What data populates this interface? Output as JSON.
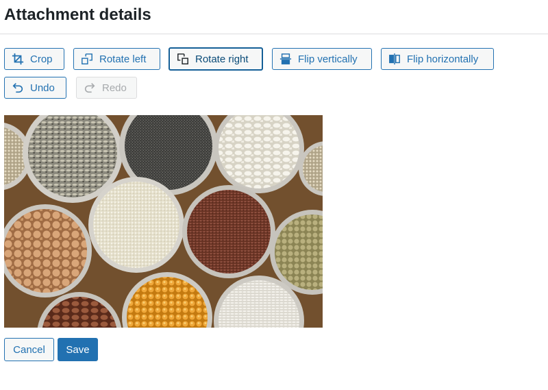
{
  "page": {
    "title": "Attachment details"
  },
  "toolbar": {
    "crop_label": "Crop",
    "rotate_left_label": "Rotate left",
    "rotate_right_label": "Rotate right",
    "flip_vertical_label": "Flip vertically",
    "flip_horizontal_label": "Flip horizontally",
    "undo_label": "Undo",
    "redo_label": "Redo"
  },
  "icons": [
    "crop-icon",
    "rotate-left-icon",
    "rotate-right-icon",
    "flip-vertical-icon",
    "flip-horizontal-icon",
    "undo-icon",
    "redo-icon"
  ],
  "actions": {
    "cancel_label": "Cancel",
    "save_label": "Save"
  },
  "colors": {
    "accent": "#2271b1",
    "accent_dark": "#135e96",
    "disabled": "#a7aaad",
    "divider": "#dcdcde",
    "text": "#1d2327"
  }
}
